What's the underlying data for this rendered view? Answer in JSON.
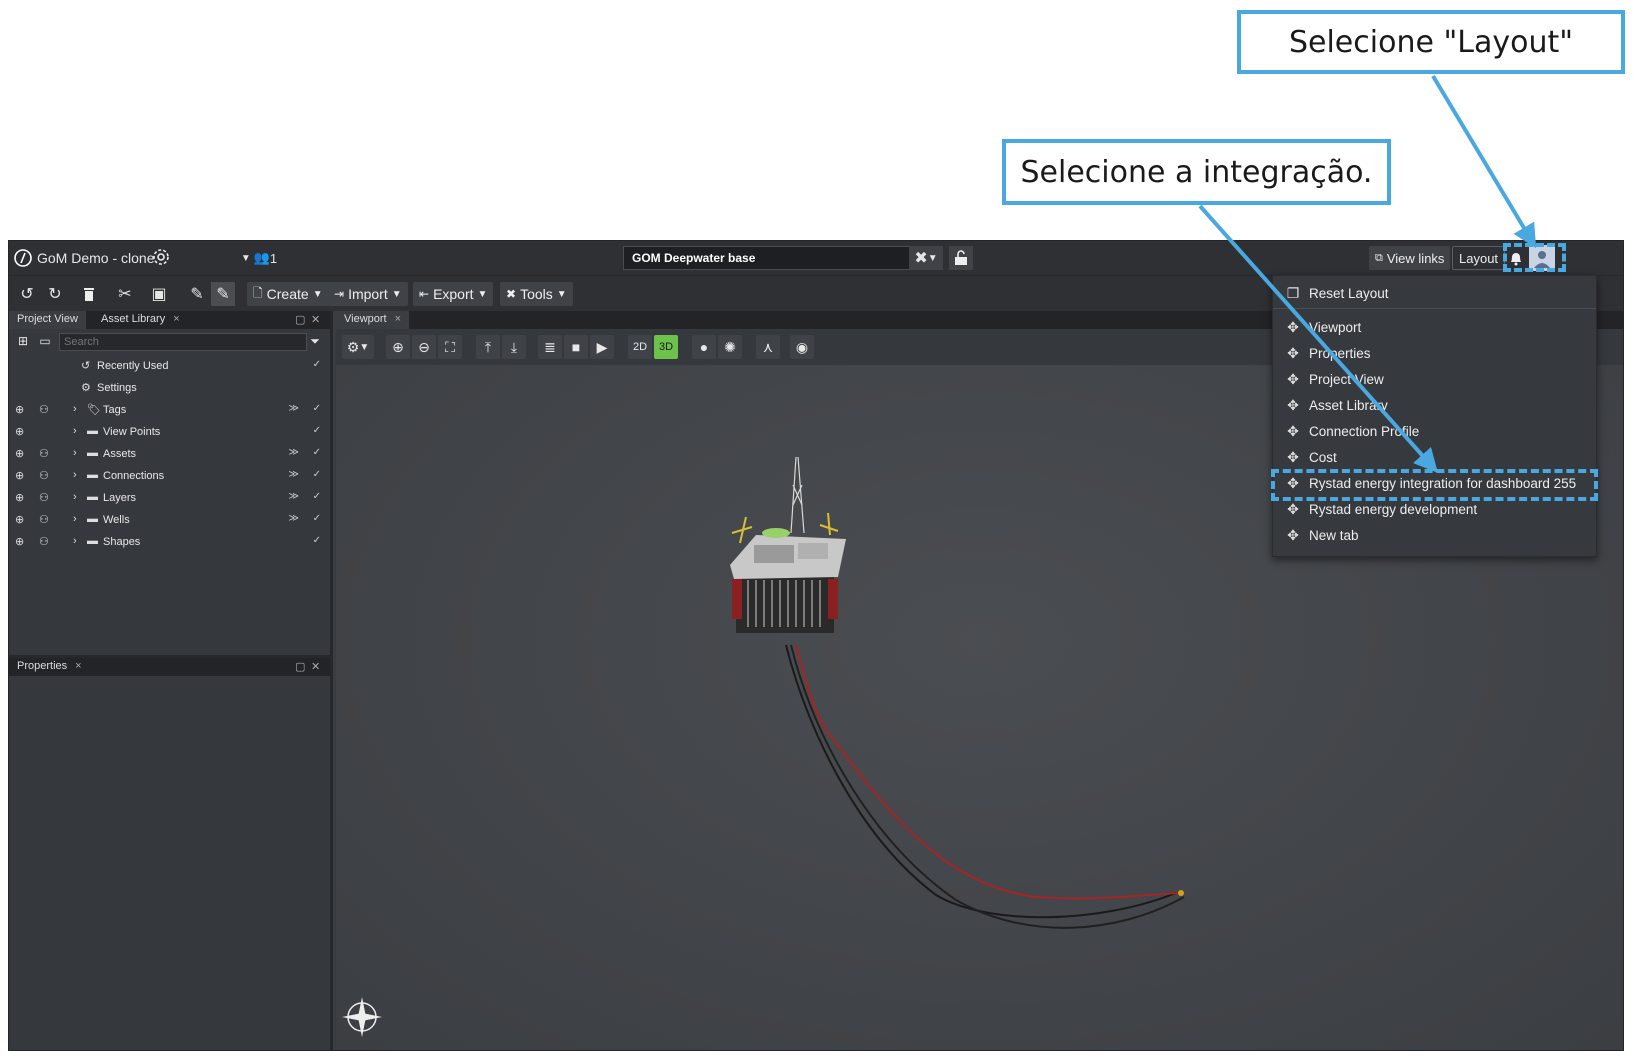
{
  "callouts": {
    "layout": "Selecione \"Layout\"",
    "integration": "Selecione a integração."
  },
  "titlebar": {
    "project_name": "GoM Demo - clone",
    "users_count": "1",
    "document_name": "GOM Deepwater base",
    "view_links": "View links",
    "layout": "Layout"
  },
  "toolbar": {
    "create": "Create",
    "import": "Import",
    "export": "Export",
    "tools": "Tools"
  },
  "left_panel": {
    "tabs": [
      "Project View",
      "Asset Library"
    ],
    "search_placeholder": "Search",
    "tree": [
      {
        "label": "Recently Used",
        "icon": "history-icon"
      },
      {
        "label": "Settings",
        "icon": "gear-icon"
      },
      {
        "label": "Tags",
        "icon": "tag-icon"
      },
      {
        "label": "View Points",
        "icon": "folder-icon"
      },
      {
        "label": "Assets",
        "icon": "folder-icon"
      },
      {
        "label": "Connections",
        "icon": "folder-icon"
      },
      {
        "label": "Layers",
        "icon": "folder-icon"
      },
      {
        "label": "Wells",
        "icon": "folder-icon"
      },
      {
        "label": "Shapes",
        "icon": "folder-icon"
      }
    ],
    "properties_tab": "Properties"
  },
  "viewport": {
    "tab": "Viewport",
    "mode_2d": "2D",
    "mode_3d": "3D",
    "active_mode": "3D"
  },
  "layout_menu": {
    "items": [
      {
        "label": "Reset Layout",
        "icon": "reset-layout-icon"
      },
      {
        "label": "Viewport",
        "icon": "move-icon"
      },
      {
        "label": "Properties",
        "icon": "move-icon"
      },
      {
        "label": "Project View",
        "icon": "move-icon"
      },
      {
        "label": "Asset Library",
        "icon": "move-icon"
      },
      {
        "label": "Connection Profile",
        "icon": "move-icon"
      },
      {
        "label": "Cost",
        "icon": "move-icon"
      },
      {
        "label": "Rystad energy integration for dashboard 255",
        "icon": "move-icon"
      },
      {
        "label": "Rystad energy development",
        "icon": "move-icon"
      },
      {
        "label": "New tab",
        "icon": "move-icon"
      }
    ],
    "highlighted_item": "Rystad energy integration for dashboard 255"
  },
  "colors": {
    "callout_border": "#4aa8e0",
    "app_bg": "#3a3d42",
    "accent_3d": "#6cc24a",
    "riser_red": "#b02020"
  }
}
